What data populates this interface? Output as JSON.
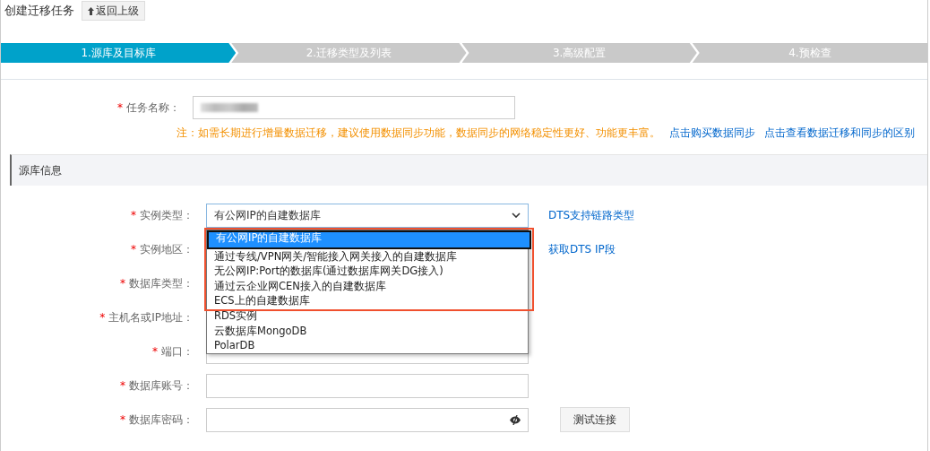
{
  "header": {
    "title": "创建迁移任务",
    "back_button": "返回上级"
  },
  "steps": [
    {
      "label": "1.源库及目标库",
      "selected": true
    },
    {
      "label": "2.迁移类型及列表",
      "selected": false
    },
    {
      "label": "3.高级配置",
      "selected": false
    },
    {
      "label": "4.预检查",
      "selected": false
    }
  ],
  "task_name": {
    "mark": "*",
    "label": "任务名称："
  },
  "note": {
    "text": "注：如需长期进行增量数据迁移，建议使用数据同步功能，数据同步的网络稳定性更好、功能更丰富。",
    "links": [
      "点击购买数据同步",
      "点击查看数据迁移和同步的区别"
    ]
  },
  "section": {
    "title": "源库信息"
  },
  "fields": [
    {
      "mark": "*",
      "label": "实例类型：",
      "kind": "select",
      "value": "有公网IP的自建数据库",
      "link": "DTS支持链路类型"
    },
    {
      "mark": "*",
      "label": "实例地区：",
      "kind": "hidden",
      "link": "获取DTS IP段"
    },
    {
      "mark": "*",
      "label": "数据库类型：",
      "kind": "hidden"
    },
    {
      "mark": "*",
      "label": "主机名或IP地址：",
      "kind": "hidden"
    },
    {
      "mark": "*",
      "label": "端口：",
      "kind": "input"
    },
    {
      "mark": "*",
      "label": "数据库账号：",
      "kind": "input"
    },
    {
      "mark": "*",
      "label": "数据库密码：",
      "kind": "password",
      "button": "测试连接"
    }
  ],
  "dropdown": {
    "options": [
      {
        "label": "有公网IP的自建数据库",
        "selected": true,
        "boxed": true
      },
      {
        "label": "通过专线/VPN网关/智能接入网关接入的自建数据库",
        "selected": false,
        "boxed": true
      },
      {
        "label": "无公网IP:Port的数据库(通过数据库网关DG接入)",
        "selected": false,
        "boxed": true
      },
      {
        "label": "通过云企业网CEN接入的自建数据库",
        "selected": false,
        "boxed": true
      },
      {
        "label": "ECS上的自建数据库",
        "selected": false,
        "boxed": true
      },
      {
        "label": "RDS实例",
        "selected": false,
        "boxed": false
      },
      {
        "label": "云数据库MongoDB",
        "selected": false,
        "boxed": false
      },
      {
        "label": "PolarDB",
        "selected": false,
        "boxed": false
      }
    ]
  }
}
